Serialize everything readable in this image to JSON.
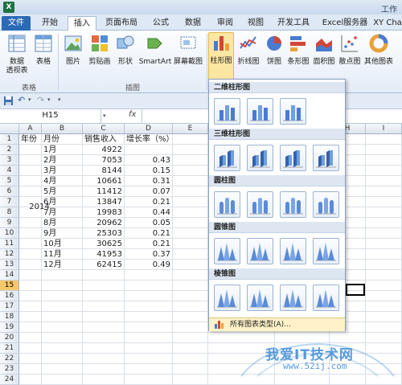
{
  "titlebar": {
    "qa_text": "",
    "window_title": "工作"
  },
  "tabs": [
    {
      "label": "文件"
    },
    {
      "label": "开始"
    },
    {
      "label": "插入"
    },
    {
      "label": "页面布局"
    },
    {
      "label": "公式"
    },
    {
      "label": "数据"
    },
    {
      "label": "审阅"
    },
    {
      "label": "视图"
    },
    {
      "label": "开发工具"
    },
    {
      "label": "Excel服务器"
    },
    {
      "label": "XY Cha"
    }
  ],
  "ribbon": {
    "buttons": [
      {
        "label": "数据\n透视表"
      },
      {
        "label": "表格"
      },
      {
        "label": "图片"
      },
      {
        "label": "剪贴画"
      },
      {
        "label": "形状"
      },
      {
        "label": "SmartArt"
      },
      {
        "label": "屏幕截图"
      },
      {
        "label": "柱形图"
      },
      {
        "label": "折线图"
      },
      {
        "label": "饼图"
      },
      {
        "label": "条形图"
      },
      {
        "label": "面积图"
      },
      {
        "label": "散点图"
      },
      {
        "label": "其他图表"
      }
    ],
    "groups": [
      {
        "label": "表格"
      },
      {
        "label": "插图"
      }
    ]
  },
  "formula": {
    "namebox": "H15",
    "fx": "fx",
    "value": ""
  },
  "columns": [
    "A",
    "B",
    "C",
    "D",
    "E",
    "F",
    "G",
    "H",
    "I"
  ],
  "rows": [
    "1",
    "2",
    "3",
    "4",
    "5",
    "6",
    "7",
    "8",
    "9",
    "10",
    "11",
    "12",
    "13",
    "14",
    "15",
    "16",
    "17",
    "18",
    "19",
    "20",
    "21",
    "22",
    "23",
    "24"
  ],
  "table": {
    "headers": [
      "年份",
      "月份",
      "销售收入",
      "增长率（%）"
    ],
    "year": "2014",
    "data": [
      [
        "1月",
        "4922",
        ""
      ],
      [
        "2月",
        "7053",
        "0.43"
      ],
      [
        "3月",
        "8144",
        "0.15"
      ],
      [
        "4月",
        "10661",
        "0.31"
      ],
      [
        "5月",
        "11412",
        "0.07"
      ],
      [
        "6月",
        "13847",
        "0.21"
      ],
      [
        "7月",
        "19983",
        "0.44"
      ],
      [
        "8月",
        "20962",
        "0.05"
      ],
      [
        "9月",
        "25303",
        "0.21"
      ],
      [
        "10月",
        "30625",
        "0.21"
      ],
      [
        "11月",
        "41953",
        "0.37"
      ],
      [
        "12月",
        "62415",
        "0.49"
      ]
    ]
  },
  "chart_menu": {
    "sections": [
      {
        "title": "二维柱形图",
        "count": 3
      },
      {
        "title": "三维柱形图",
        "count": 4
      },
      {
        "title": "圆柱图",
        "count": 4
      },
      {
        "title": "圆锥图",
        "count": 4
      },
      {
        "title": "棱锥图",
        "count": 4
      }
    ],
    "all_types": "所有图表类型(A)..."
  },
  "watermark": {
    "text": "我爱IT技术网",
    "url": "www.52ij.com"
  },
  "colors": {
    "file_tab": "#2a6ab7",
    "selected_row": "#f5c86a",
    "menu_highlight": "#fff2c8",
    "watermark": "#3d8ad6"
  }
}
